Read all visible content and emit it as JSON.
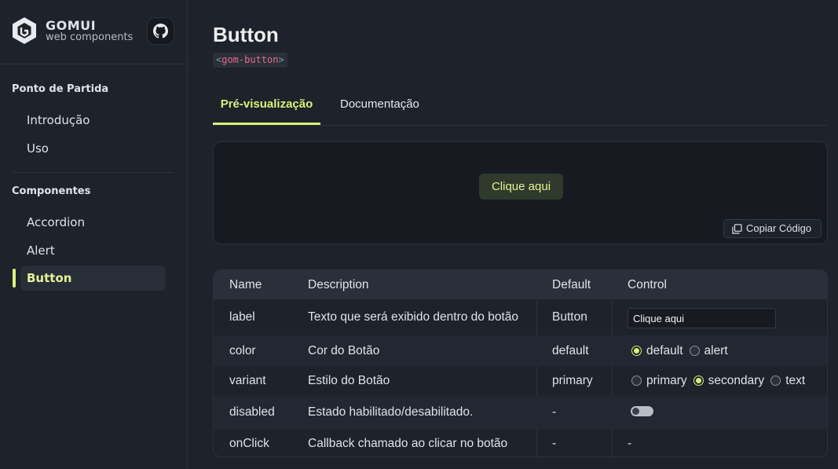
{
  "brand": {
    "name": "GOMUI",
    "subtitle": "web components"
  },
  "sidebar": {
    "sections": [
      {
        "title": "Ponto de Partida",
        "items": [
          "Introdução",
          "Uso"
        ]
      },
      {
        "title": "Componentes",
        "items": [
          "Accordion",
          "Alert",
          "Button"
        ]
      }
    ],
    "active_item": "Button"
  },
  "page": {
    "title": "Button",
    "tag_open": "<",
    "tag_name": "gom-button",
    "tag_close": ">"
  },
  "tabs": [
    {
      "label": "Pré-visualização",
      "active": true
    },
    {
      "label": "Documentação",
      "active": false
    }
  ],
  "preview": {
    "button_label": "Clique aqui",
    "copy_label": "Copiar Código"
  },
  "props_table": {
    "headers": [
      "Name",
      "Description",
      "Default",
      "Control"
    ],
    "rows": [
      {
        "name": "label",
        "description": "Texto que será exibido dentro do botão",
        "default": "Button",
        "control_value": "Clique aqui"
      },
      {
        "name": "color",
        "description": "Cor do Botão",
        "default": "default",
        "options": [
          "default",
          "alert"
        ],
        "selected": "default"
      },
      {
        "name": "variant",
        "description": "Estilo do Botão",
        "default": "primary",
        "options": [
          "primary",
          "secondary",
          "text"
        ],
        "selected": "secondary"
      },
      {
        "name": "disabled",
        "description": "Estado habilitado/desabilitado.",
        "default": "-",
        "toggle_on": false
      },
      {
        "name": "onClick",
        "description": "Callback chamado ao clicar no botão",
        "default": "-",
        "control_text": "-"
      }
    ]
  },
  "colors": {
    "accent": "#d9f07a",
    "background": "#1d222b",
    "panel": "#171b21",
    "tag_text": "#e36a88"
  }
}
